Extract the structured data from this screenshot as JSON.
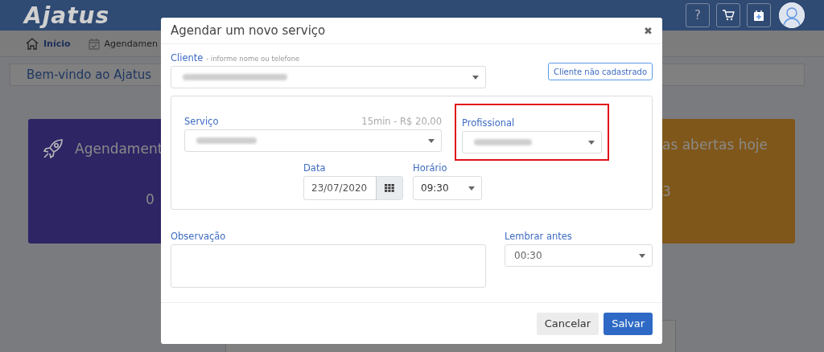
{
  "header": {
    "logo": "Ajatus",
    "help": "?"
  },
  "nav": [
    {
      "label": "Início",
      "selected": true
    },
    {
      "label": "Agendamen",
      "selected": false
    }
  ],
  "welcome": "Bem-vindo ao Ajatus",
  "cards": [
    {
      "title": "Agendament",
      "value": "0",
      "color": "#2e2565"
    },
    {
      "title": "as abertas hoje",
      "value": "3",
      "color": "#80571a"
    }
  ],
  "modal": {
    "title": "Agendar um novo serviço",
    "close": "✖",
    "client": {
      "label": "Cliente",
      "hint": "- informe nome ou telefone"
    },
    "new_client_button": "Cliente não cadastrado",
    "service": {
      "label": "Serviço",
      "price": "15min - R$ 20,00"
    },
    "professional": {
      "label": "Profissional",
      "highlighted": true
    },
    "date": {
      "label": "Data",
      "value": "23/07/2020"
    },
    "time": {
      "label": "Horário",
      "value": "09:30"
    },
    "note": {
      "label": "Observação"
    },
    "remind": {
      "label": "Lembrar antes",
      "value": "00:30"
    },
    "buttons": [
      {
        "label": "Cancelar",
        "kind": "secondary"
      },
      {
        "label": "Salvar",
        "kind": "primary"
      }
    ]
  }
}
